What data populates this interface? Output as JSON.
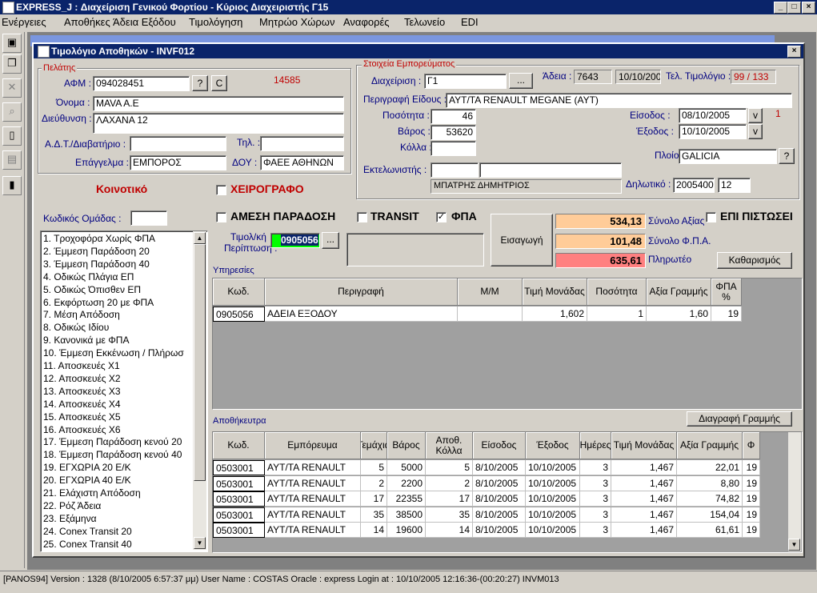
{
  "app": {
    "title": "EXPRESS_J : Διαχείριση Γενικού Φορτίου - Κύριος Διαχειριστής Γ15"
  },
  "menu": [
    "Ενέργειες",
    "Αποθήκες",
    "Άδεια Εξόδου",
    "Τιμολόγηση",
    "Μητρώο Χώρων",
    "Αναφορές",
    "Τελωνείο",
    "EDI"
  ],
  "window": {
    "title": "Τιμολόγιο Αποθηκών - INVF012"
  },
  "customer": {
    "group_label": "Πελάτης",
    "afm_label": "ΑΦΜ :",
    "afm": "094028451",
    "q_btn": "?",
    "c_btn": "C",
    "code": "14585",
    "name_label": "Όνομα :",
    "name": "MAVA A.E",
    "address_label": "Διεύθυνση :",
    "address": "ΛΑΧΑΝΑ 12",
    "id_label": "Α.Δ.Τ./Διαβατήριο :",
    "id": "",
    "phone_label": "Τηλ. :",
    "phone": "",
    "profession_label": "Επάγγελμα :",
    "profession": "ΕΜΠΟΡΟΣ",
    "doy_label": "ΔΟΥ :",
    "doy": "ΦΑΕΕ ΑΘΗΝΩΝ"
  },
  "goods": {
    "group_label": "Στοιχεία Εμπορεύματος",
    "management_label": "Διαχείριση :",
    "management": "Γ1",
    "ellipsis": "...",
    "permit_label": "Άδεια :",
    "permit_no": "7643",
    "permit_date": "10/10/200",
    "last_invoice_label": "Τελ. Τιμολόγιο :",
    "last_invoice": "99 / 133",
    "desc_label": "Περιγραφή Είδους :",
    "desc": "ΑΥΤ/ΤΑ RENAULT MEGANE (ΑΥΤ)",
    "qty_label": "Ποσότητα :",
    "qty": "46",
    "weight_label": "Βάρος :",
    "weight": "53620",
    "packages_label": "Κόλλα :",
    "packages": "",
    "entry_label": "Είσοδος :",
    "entry": "08/10/2005",
    "v": "v",
    "one": "1",
    "exit_label": "Έξοδος :",
    "exit": "10/10/2005",
    "ship_label": "Πλοίο :",
    "ship": "GALICIA",
    "ship_q": "?",
    "customs_label": "Εκτελωνιστής :",
    "customs_code": "",
    "customs_name": "",
    "customs_person": "ΜΠΑΤΡΗΣ ΔΗΜΗΤΡΙΟΣ",
    "declaration_label": "Δηλωτικό :",
    "declaration": "2005400",
    "declaration2": "12"
  },
  "flags": {
    "koinotiko": "Κοινοτικό",
    "xeirografo": "ΧΕΙΡΟΓΡΑΦΟ",
    "direct": "ΑΜΕΣΗ ΠΑΡΑΔΟΣΗ",
    "transit": "TRANSIT",
    "fpa": "ΦΠΑ",
    "fpa_check": "✓",
    "credit": "ΕΠΙ ΠΙΣΤΩΣΕΙ"
  },
  "groups": {
    "label": "Κωδικός Ομάδας :",
    "value": "",
    "items": [
      "1. Τροχοφόρα Χωρίς ΦΠΑ",
      "2. Έμμεση Παράδοση 20",
      "3. Έμμεση Παράδοση 40",
      "4. Οδικώς Πλάγια ΕΠ",
      "5. Οδικώς Όπισθεν ΕΠ",
      "6. Εκφόρτωση 20 με ΦΠΑ",
      "7. Μέση Απόδοση",
      "8. Οδικώς Ιδίου",
      "9. Κανονικά με ΦΠΑ",
      "10. Έμμεση Εκκένωση / Πλήρωσ",
      "11. Αποσκευές Χ1",
      "12. Αποσκευές Χ2",
      "13. Αποσκευές Χ3",
      "14. Αποσκευές Χ4",
      "15. Αποσκευές Χ5",
      "16. Αποσκευές Χ6",
      "17. Έμμεση Παράδοση κενού 20",
      "18. Έμμεση Παράδοση κενού 40",
      "19. ΕΓΧΩΡΙΑ 20 Ε/Κ",
      "20. ΕΓΧΩΡΙΑ 40 Ε/Κ",
      "21. Ελάχιστη Απόδοση",
      "22. Ρόζ Άδεια",
      "23. Εξάμηνα",
      "24. Conex Transit 20",
      "25. Conex Transit 40"
    ]
  },
  "invoice": {
    "case_label1": "Τιμολ/κή",
    "case_label2": "Περίπτωση :",
    "case_value": "0905056",
    "ellipsis": "...",
    "import_btn": "Εισαγωγή",
    "total_value": "534,13",
    "total_value_label": "Σύνολο Αξίας",
    "total_vat": "101,48",
    "total_vat_label": "Σύνολο Φ.Π.Α.",
    "payable": "635,61",
    "payable_label": "Πληρωτέο",
    "clear_btn": "Καθαρισμός"
  },
  "services": {
    "label": "Υπηρεσίες",
    "headers": [
      "Κωδ.",
      "Περιγραφή",
      "Μ/Μ",
      "Τιμή Μονάδας",
      "Ποσότητα",
      "Αξία Γραμμής",
      "ΦΠΑ %"
    ],
    "rows": [
      [
        "0905056",
        "ΑΔΕΙΑ ΕΞΟΔΟΥ",
        "",
        "1,602",
        "1",
        "1,60",
        "19"
      ]
    ]
  },
  "storage": {
    "label": "Αποθήκευτρα",
    "delete_btn": "Διαγραφή Γραμμής",
    "headers": [
      "Κωδ.",
      "Εμπόρευμα",
      "Τεμάχια",
      "Βάρος",
      "Αποθ. Κόλλα",
      "Είσοδος",
      "Έξοδος",
      "Ημέρες",
      "Τιμή Μονάδας",
      "Αξία Γραμμής",
      "Φ"
    ],
    "rows": [
      [
        "0503001",
        "ΑΥΤ/ΤΑ RENAULT",
        "5",
        "5000",
        "5",
        "8/10/2005",
        "10/10/2005",
        "3",
        "1,467",
        "22,01",
        "19"
      ],
      [
        "0503001",
        "ΑΥΤ/ΤΑ RENAULT",
        "2",
        "2200",
        "2",
        "8/10/2005",
        "10/10/2005",
        "3",
        "1,467",
        "8,80",
        "19"
      ],
      [
        "0503001",
        "ΑΥΤ/ΤΑ RENAULT",
        "17",
        "22355",
        "17",
        "8/10/2005",
        "10/10/2005",
        "3",
        "1,467",
        "74,82",
        "19"
      ],
      [
        "0503001",
        "ΑΥΤ/ΤΑ RENAULT",
        "35",
        "38500",
        "35",
        "8/10/2005",
        "10/10/2005",
        "3",
        "1,467",
        "154,04",
        "19"
      ],
      [
        "0503001",
        "ΑΥΤ/ΤΑ RENAULT",
        "14",
        "19600",
        "14",
        "8/10/2005",
        "10/10/2005",
        "3",
        "1,467",
        "61,61",
        "19"
      ]
    ]
  },
  "status": {
    "text": "[PANOS94] Version : 1328 (8/10/2005 6:57:37 μμ)  User Name : COSTAS  Oracle : express  Login at : 10/10/2005 12:16:36-(00:20:27)  INVM013"
  },
  "colors": {
    "title_bar": "#0a246a",
    "total_value_bg": "#ffcc99",
    "total_vat_bg": "#ffcc99",
    "payable_bg": "#ff8080",
    "label_red": "#c00000",
    "label_blue": "#000080"
  }
}
